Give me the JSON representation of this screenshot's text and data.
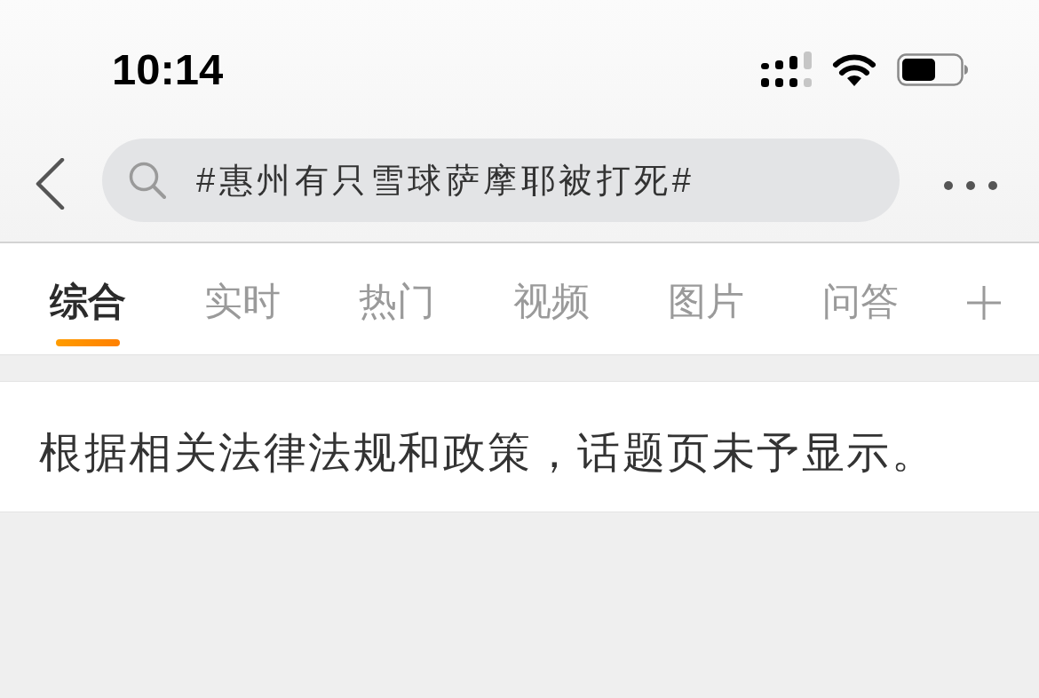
{
  "status_bar": {
    "time": "10:14"
  },
  "search": {
    "value": "#惠州有只雪球萨摩耶被打死#"
  },
  "tabs": [
    {
      "label": "综合",
      "selected": true
    },
    {
      "label": "实时",
      "selected": false
    },
    {
      "label": "热门",
      "selected": false
    },
    {
      "label": "视频",
      "selected": false
    },
    {
      "label": "图片",
      "selected": false
    },
    {
      "label": "问答",
      "selected": false
    }
  ],
  "notice": "根据相关法律法规和政策，话题页未予显示。"
}
